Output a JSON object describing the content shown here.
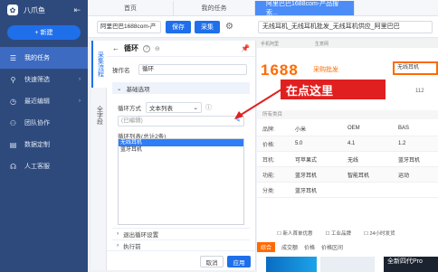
{
  "sidebar": {
    "brand": "八爪鱼",
    "new_label": "+ 新建",
    "items": [
      {
        "label": "我的任务",
        "icon": "task-list-icon",
        "active": true
      },
      {
        "label": "快速筛选",
        "icon": "filter-icon",
        "has_arrow": true
      },
      {
        "label": "最近编辑",
        "icon": "clock-icon",
        "has_arrow": true
      },
      {
        "label": "团队协作",
        "icon": "team-icon"
      },
      {
        "label": "数据定制",
        "icon": "data-icon"
      },
      {
        "label": "人工客服",
        "icon": "headset-icon"
      }
    ]
  },
  "tabs": [
    {
      "label": "首页"
    },
    {
      "label": "我的任务"
    },
    {
      "label": "阿里巴巴1688com-产品搜索...",
      "active": true
    }
  ],
  "toolbar": {
    "task_name": "阿里巴巴1688com-产",
    "save_label": "保存",
    "collect_label": "采集",
    "url": "无线耳机_无线耳机批发_无线耳机供应_阿里巴巴"
  },
  "vtabs": [
    {
      "label": "采集流程",
      "active": true
    },
    {
      "label": "全字段"
    }
  ],
  "panel": {
    "title": "循环",
    "op_name_label": "操作名",
    "op_name_value": "循环",
    "section_basic": "基础选项",
    "loop_mode_label": "循环方式",
    "loop_mode_value": "文本列表",
    "input_placeholder": "(已编辑)",
    "list_label": "循环列表(总计2条)",
    "list_items": [
      "无线耳机",
      "蓝牙耳机"
    ],
    "section_exit": "退出循环设置",
    "section_exec": "执行前",
    "cancel_label": "取消",
    "apply_label": "应用"
  },
  "webview": {
    "top_links": [
      "手机阿里",
      "生意网"
    ],
    "logo_text": "1688",
    "logo_sub": "采购批发",
    "search_value": "无线耳机",
    "tooltip": "在点这里",
    "sub_text": "112",
    "category_text": "所有类目",
    "table": [
      [
        "品牌:",
        "小米",
        "OEM",
        "BAS"
      ],
      [
        "价格:",
        "5.0",
        "4.1",
        "1.2"
      ],
      [
        "耳机:",
        "可苹果式",
        "无线",
        "蓝牙耳机"
      ],
      [
        "功能:",
        "蓝牙耳机",
        "智能耳机",
        "运动"
      ],
      [
        "分类:",
        "蓝牙耳机",
        "",
        ""
      ]
    ],
    "filters": [
      "新人首单优惠",
      "工业品牌",
      "24小时发货"
    ],
    "sort": [
      "综合",
      "成交额",
      "价格",
      "价格区间"
    ],
    "product3_text": "全新四代Pro"
  },
  "colors": {
    "sidebar_bg": "#2e4a7d",
    "accent": "#1f6feb",
    "tooltip_red": "#e02020",
    "brand_orange": "#ff6a00"
  }
}
